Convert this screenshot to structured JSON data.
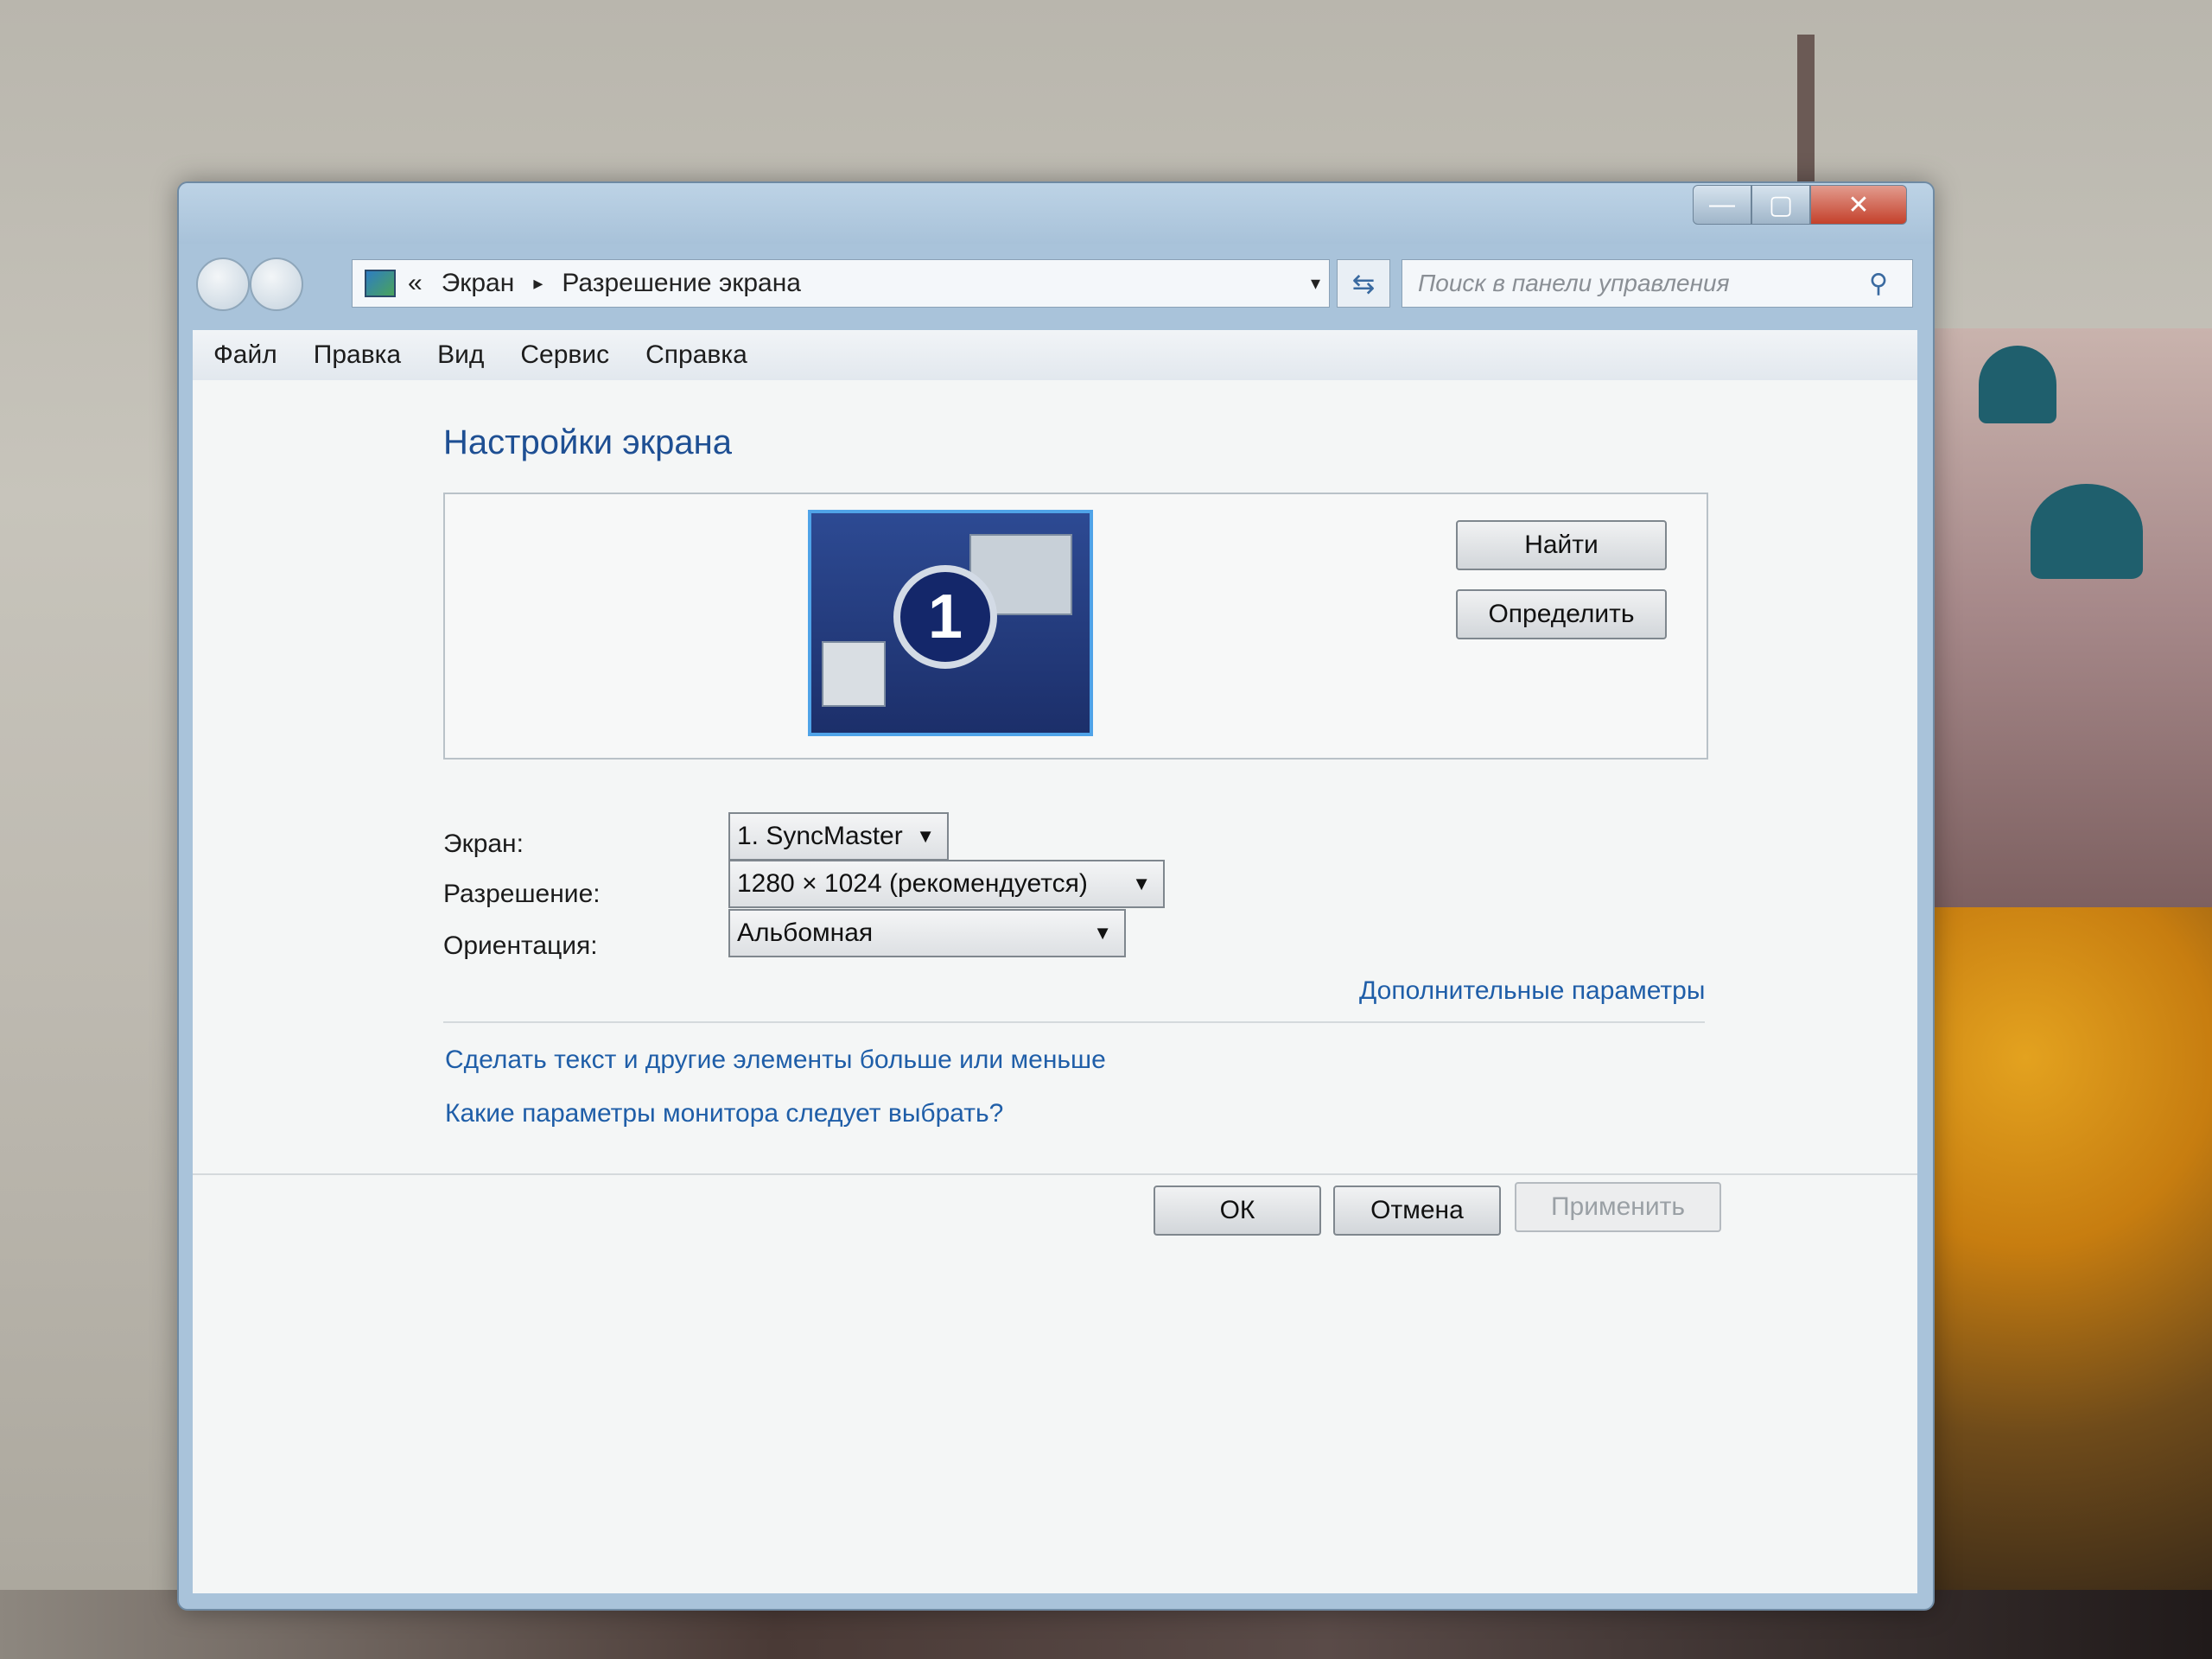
{
  "window": {
    "controls": {
      "minimize": "—",
      "maximize": "▢",
      "close": "✕"
    }
  },
  "address_bar": {
    "chevrons": "«",
    "crumbs": [
      "Экран",
      "Разрешение экрана"
    ],
    "separator": "▸",
    "dropdown": "▾"
  },
  "search": {
    "placeholder": "Поиск в панели управления",
    "icon": "search-icon"
  },
  "menu": [
    "Файл",
    "Правка",
    "Вид",
    "Сервис",
    "Справка"
  ],
  "page": {
    "heading": "Настройки экрана",
    "monitor_number": "1",
    "buttons": {
      "find": "Найти",
      "identify": "Определить"
    },
    "fields": {
      "display_label": "Экран:",
      "display_value": "1. SyncMaster",
      "resolution_label": "Разрешение:",
      "resolution_value": "1280 × 1024 (рекомендуется)",
      "orientation_label": "Ориентация:",
      "orientation_value": "Альбомная"
    },
    "links": {
      "advanced": "Дополнительные параметры",
      "text_size": "Сделать текст и другие элементы больше или меньше",
      "which_settings": "Какие параметры монитора следует выбрать?"
    },
    "footer": {
      "ok": "ОК",
      "cancel": "Отмена",
      "apply": "Применить"
    }
  },
  "colors": {
    "link": "#1f5ea8",
    "heading": "#1e4f93",
    "window_frame": "#a9c3da"
  }
}
